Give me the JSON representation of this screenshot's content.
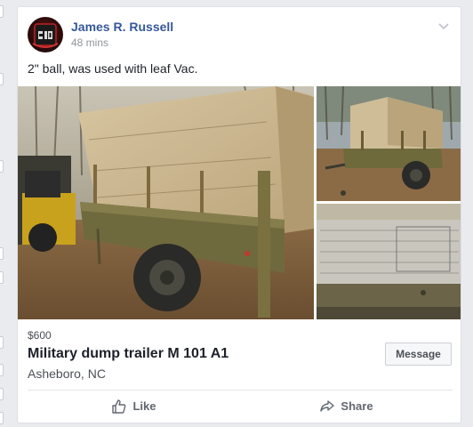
{
  "post": {
    "author": "James R. Russell",
    "time": "48 mins",
    "text": "2\" ball, was used with leaf Vac."
  },
  "listing": {
    "price": "$600",
    "title": "Military dump trailer M 101 A1",
    "location": "Asheboro, NC",
    "message_label": "Message"
  },
  "actions": {
    "like_label": "Like",
    "share_label": "Share"
  },
  "icons": {
    "avatar": "profile-avatar",
    "menu": "chevron-down-icon",
    "like": "thumbs-up-icon",
    "share": "share-arrow-icon"
  },
  "colors": {
    "author_link": "#365899",
    "page_bg": "#e9ebee"
  }
}
